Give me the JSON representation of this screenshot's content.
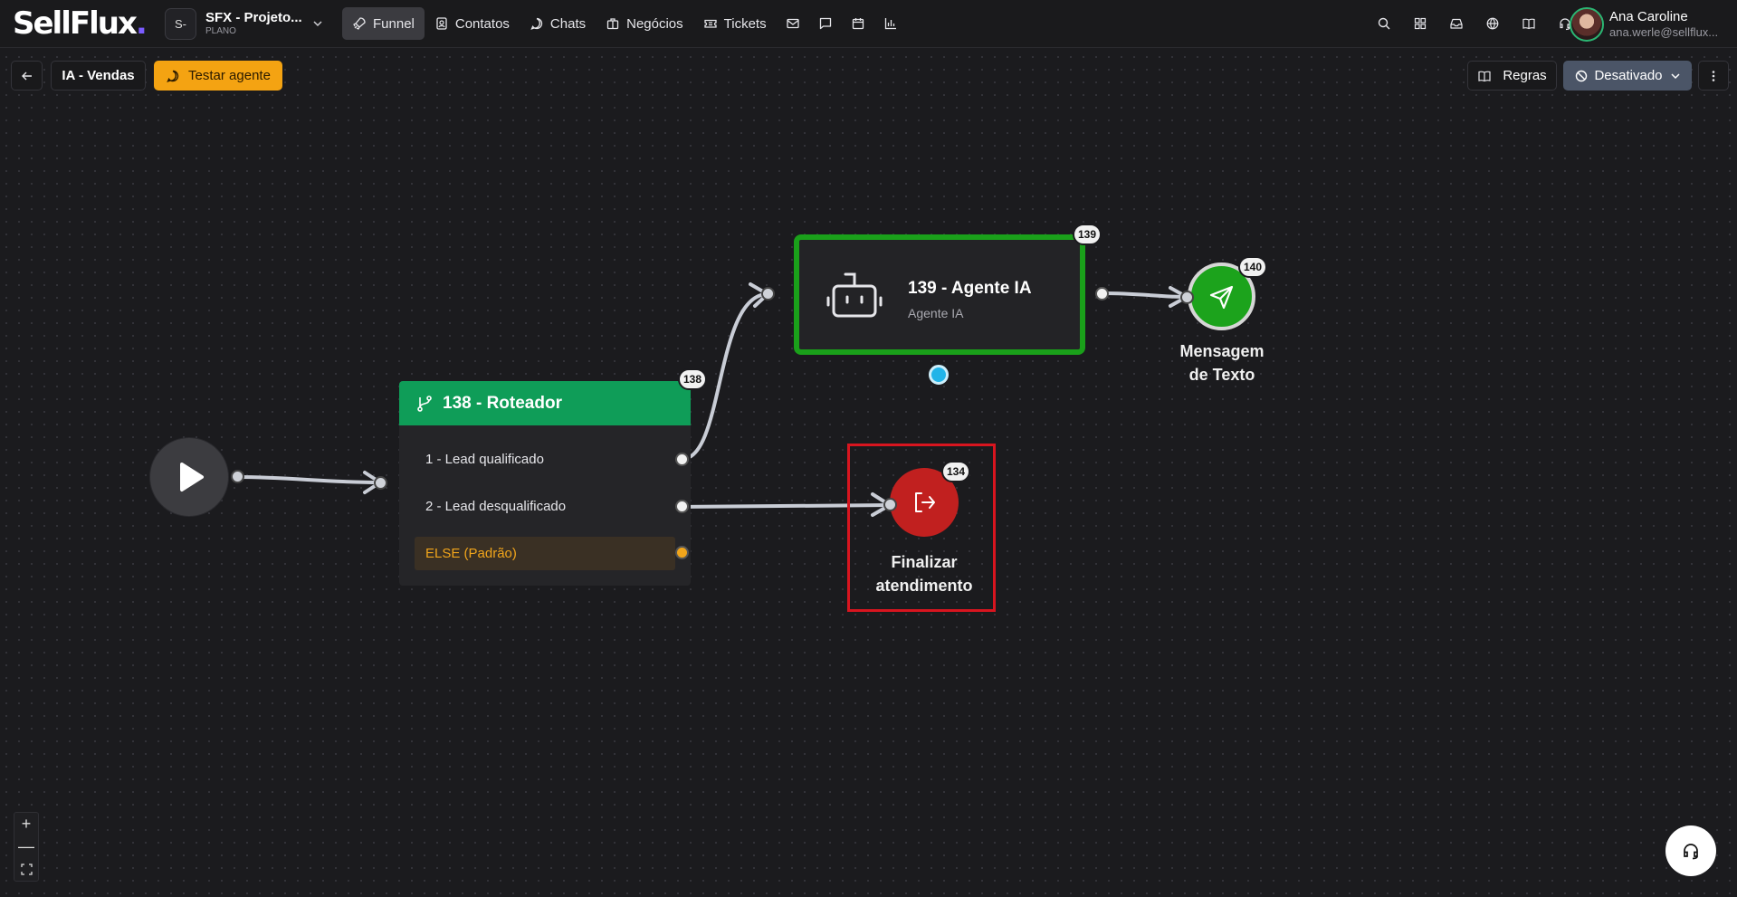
{
  "brand": {
    "logo_text": "SellFlux",
    "logo_dot": "."
  },
  "project": {
    "avatar": "S-",
    "name": "SFX - Projeto...",
    "plan": "PLANO"
  },
  "nav": {
    "items": [
      {
        "label": "Funnel",
        "icon": "rocket-icon",
        "active": true
      },
      {
        "label": "Contatos",
        "icon": "contact-icon"
      },
      {
        "label": "Chats",
        "icon": "chat-icon"
      },
      {
        "label": "Negócios",
        "icon": "briefcase-icon"
      },
      {
        "label": "Tickets",
        "icon": "ticket-icon"
      }
    ],
    "icon_only": [
      "mail-icon",
      "message-square-icon",
      "calendar-icon",
      "bar-chart-icon"
    ]
  },
  "header_icons": [
    "search-icon",
    "apps-grid-icon",
    "inbox-icon",
    "globe-icon",
    "book-icon",
    "headset-icon"
  ],
  "user": {
    "name": "Ana Caroline",
    "email": "ana.werle@sellflux..."
  },
  "toolbar": {
    "back_icon": "arrow-left-icon",
    "flow_name": "IA - Vendas",
    "test_label": "Testar agente",
    "rules_label": "Regras",
    "status_label": "Desativado",
    "more_icon": "more-vertical-icon"
  },
  "nodes": {
    "router": {
      "title": "138 - Roteador",
      "badge": "138",
      "routes": [
        "1 - Lead qualificado",
        "2 - Lead desqualificado"
      ],
      "else_label": "ELSE (Padrão)"
    },
    "agent": {
      "title": "139 - Agente IA",
      "subtitle": "Agente IA",
      "badge": "139"
    },
    "message": {
      "label_line1": "Mensagem",
      "label_line2": "de Texto",
      "badge": "140"
    },
    "finalize": {
      "label_line1": "Finalizar",
      "label_line2": "atendimento",
      "badge": "134"
    }
  },
  "colors": {
    "router_header": "#0f9d58",
    "agent_border": "#1aa01a",
    "message_node": "#1ca31c",
    "finalize_node": "#c1201f",
    "highlight_frame": "#d8151f",
    "test_button": "#f4a312",
    "else_text": "#f1a51b"
  },
  "zoom_controls": {
    "zoom_in": "+",
    "zoom_out": "—"
  }
}
